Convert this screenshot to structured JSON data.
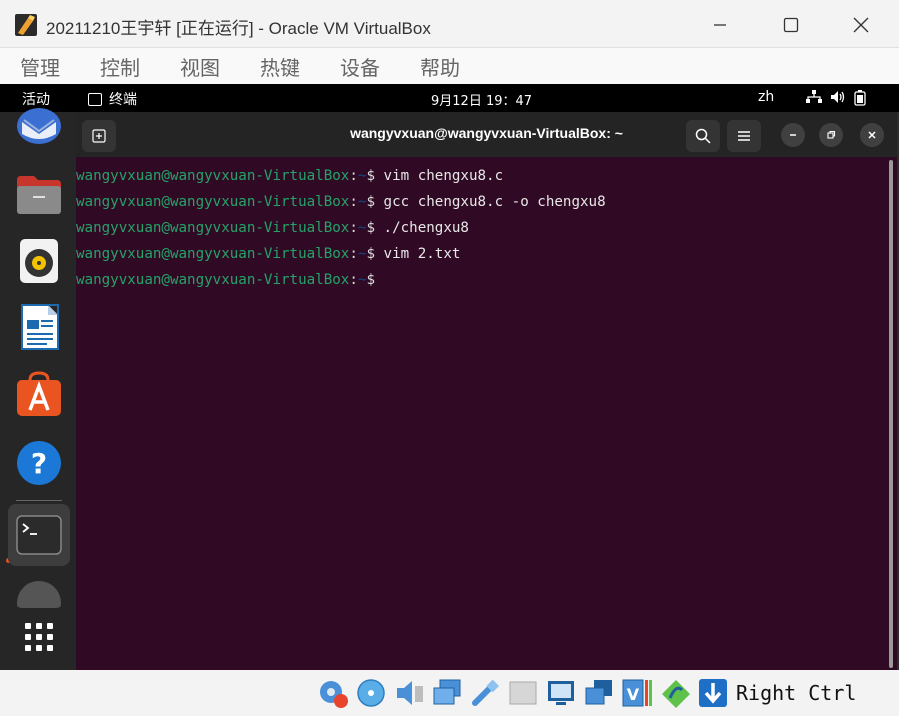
{
  "window": {
    "title": "20211210王宇轩 [正在运行] - Oracle VM VirtualBox",
    "minimize_icon": "minimize-icon",
    "maximize_icon": "maximize-icon",
    "close_icon": "close-icon"
  },
  "menubar": {
    "items": [
      "管理",
      "控制",
      "视图",
      "热键",
      "设备",
      "帮助"
    ]
  },
  "ubuntu_topbar": {
    "activities": "活动",
    "app_name": "终端",
    "clock": "9月12日 19：47",
    "input_method": "zh",
    "tray_icons": [
      "network-icon",
      "volume-icon",
      "battery-icon"
    ]
  },
  "dock": {
    "apps": [
      "thunderbird-icon",
      "files-icon",
      "rhythmbox-icon",
      "libreoffice-writer-icon",
      "app-center-icon",
      "help-icon",
      "terminal-icon",
      "disc-icon",
      "show-apps-icon"
    ],
    "active_app": "terminal-icon",
    "accent_color": "#e95420"
  },
  "terminal": {
    "title": "wangyvxuan@wangyvxuan-VirtualBox: ~",
    "background_color": "#300a24",
    "prompt_user_host": "wangyvxuan@wangyvxuan-VirtualBox",
    "prompt_path": "~",
    "lines": [
      {
        "prompt": "wangyvxuan@wangyvxuan-VirtualBox",
        "sep": ":",
        "path": "~",
        "sym": "$ ",
        "cmd": "vim chengxu8.c"
      },
      {
        "prompt": "wangyvxuan@wangyvxuan-VirtualBox",
        "sep": ":",
        "path": "~",
        "sym": "$ ",
        "cmd": "gcc chengxu8.c -o chengxu8"
      },
      {
        "prompt": "wangyvxuan@wangyvxuan-VirtualBox",
        "sep": ":",
        "path": "~",
        "sym": "$ ",
        "cmd": "./chengxu8"
      },
      {
        "prompt": "wangyvxuan@wangyvxuan-VirtualBox",
        "sep": ":",
        "path": "~",
        "sym": "$ ",
        "cmd": "vim 2.txt"
      },
      {
        "prompt": "wangyvxuan@wangyvxuan-VirtualBox",
        "sep": ":",
        "path": "~",
        "sym": "$",
        "cmd": ""
      }
    ]
  },
  "statusbar": {
    "icons": [
      "hard-disk-icon",
      "optical-drive-icon",
      "audio-icon",
      "network-adapter-icon",
      "usb-icon",
      "shared-folders-icon",
      "display-icon",
      "recording-icon",
      "virtualization-icon",
      "mouse-integration-icon",
      "keyboard-capture-icon"
    ],
    "host_key": "Right Ctrl"
  }
}
